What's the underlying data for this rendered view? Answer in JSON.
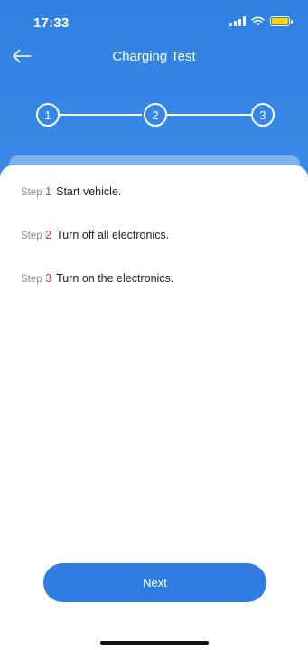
{
  "status_bar": {
    "time": "17:33",
    "signal_icon": "cellular-signal-icon",
    "wifi_icon": "wifi-icon",
    "battery_icon": "battery-icon",
    "battery_color": "#ffd400"
  },
  "header": {
    "back_icon": "arrow-left-icon",
    "title": "Charging Test"
  },
  "stepper": {
    "steps": [
      "1",
      "2",
      "3"
    ],
    "current_step": 3
  },
  "steps": [
    {
      "prefix": "Step",
      "number": "1",
      "text": "Start vehicle."
    },
    {
      "prefix": "Step",
      "number": "2",
      "text": "Turn off all electronics."
    },
    {
      "prefix": "Step",
      "number": "3",
      "text": "Turn on the electronics."
    }
  ],
  "footer": {
    "next_label": "Next"
  },
  "colors": {
    "primary": "#2f7de0",
    "step_number": "#e53935"
  }
}
